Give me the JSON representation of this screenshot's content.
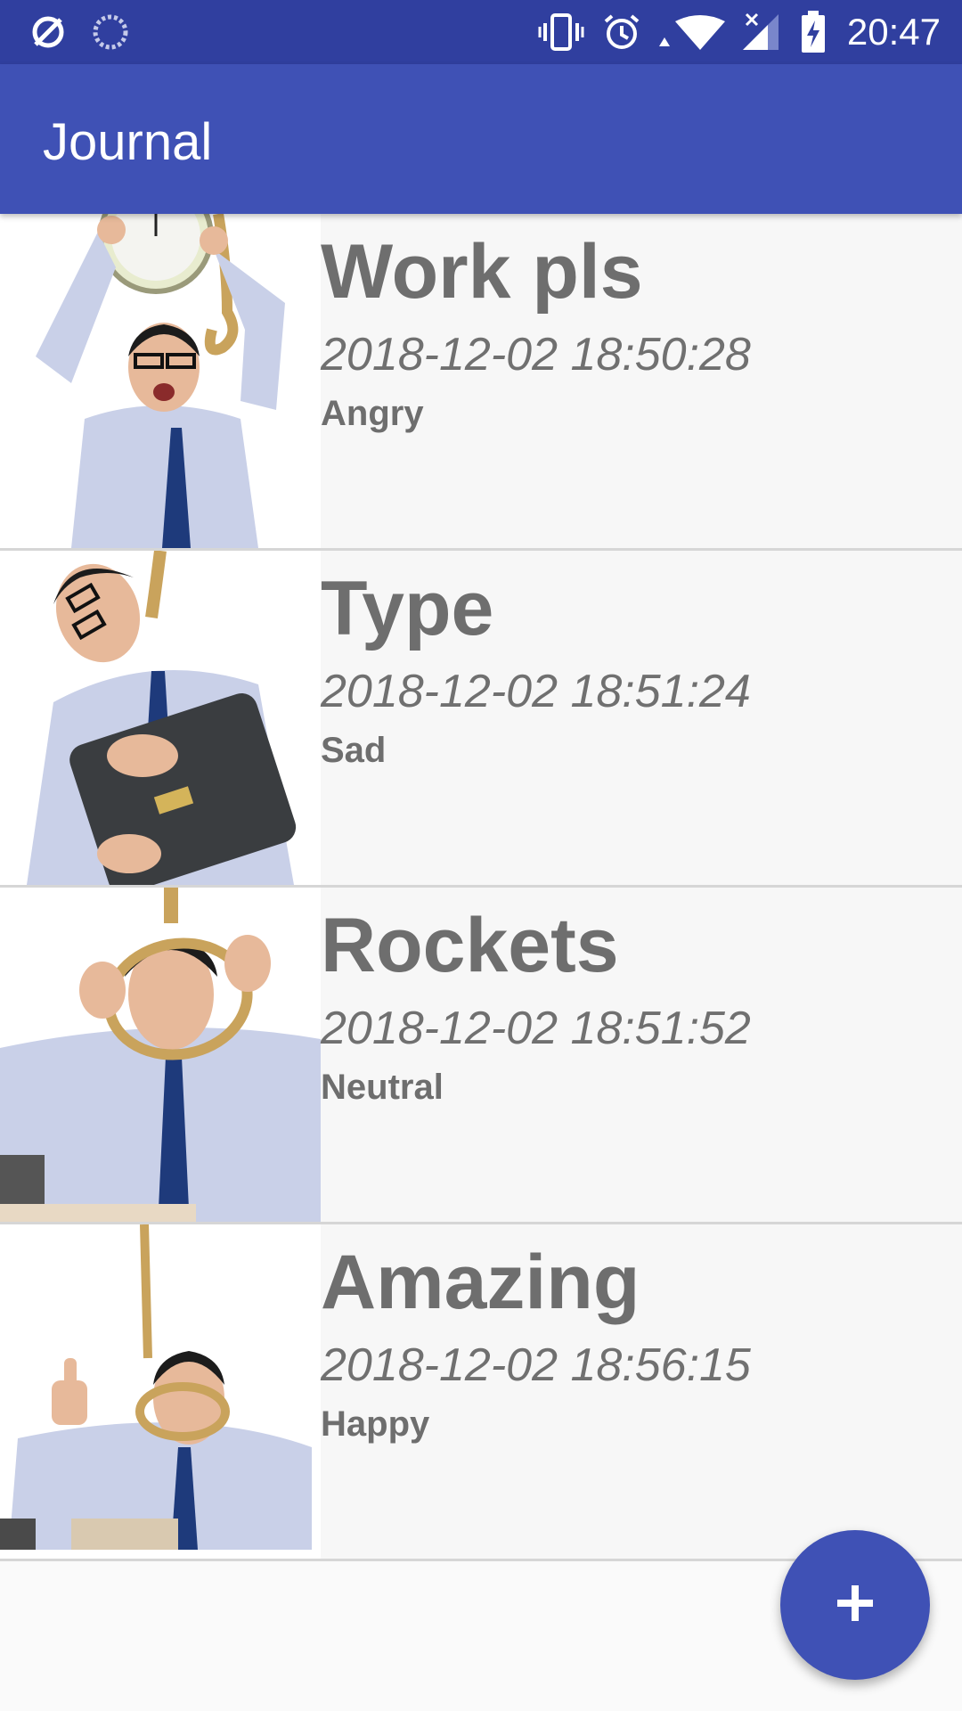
{
  "status_bar": {
    "time": "20:47",
    "left_icons": [
      "no-sync-icon",
      "loading-icon"
    ],
    "right_icons": [
      "vibrate-icon",
      "alarm-icon",
      "wifi-icon",
      "no-signal-icon",
      "battery-charging-icon"
    ]
  },
  "app_bar": {
    "title": "Journal",
    "color": "#3f51b5"
  },
  "entries": [
    {
      "title": "Work pls",
      "date": "2018-12-02 18:50:28",
      "mood": "Angry",
      "thumb": "man-with-clock-and-noose"
    },
    {
      "title": "Type",
      "date": "2018-12-02 18:51:24",
      "mood": "Sad",
      "thumb": "man-hugging-briefcase-with-noose"
    },
    {
      "title": "Rockets",
      "date": "2018-12-02 18:51:52",
      "mood": "Neutral",
      "thumb": "man-holding-noose"
    },
    {
      "title": "Amazing",
      "date": "2018-12-02 18:56:15",
      "mood": "Happy",
      "thumb": "man-thumbs-up-with-noose"
    }
  ],
  "fab": {
    "icon": "plus-icon",
    "color": "#3f51b5"
  }
}
